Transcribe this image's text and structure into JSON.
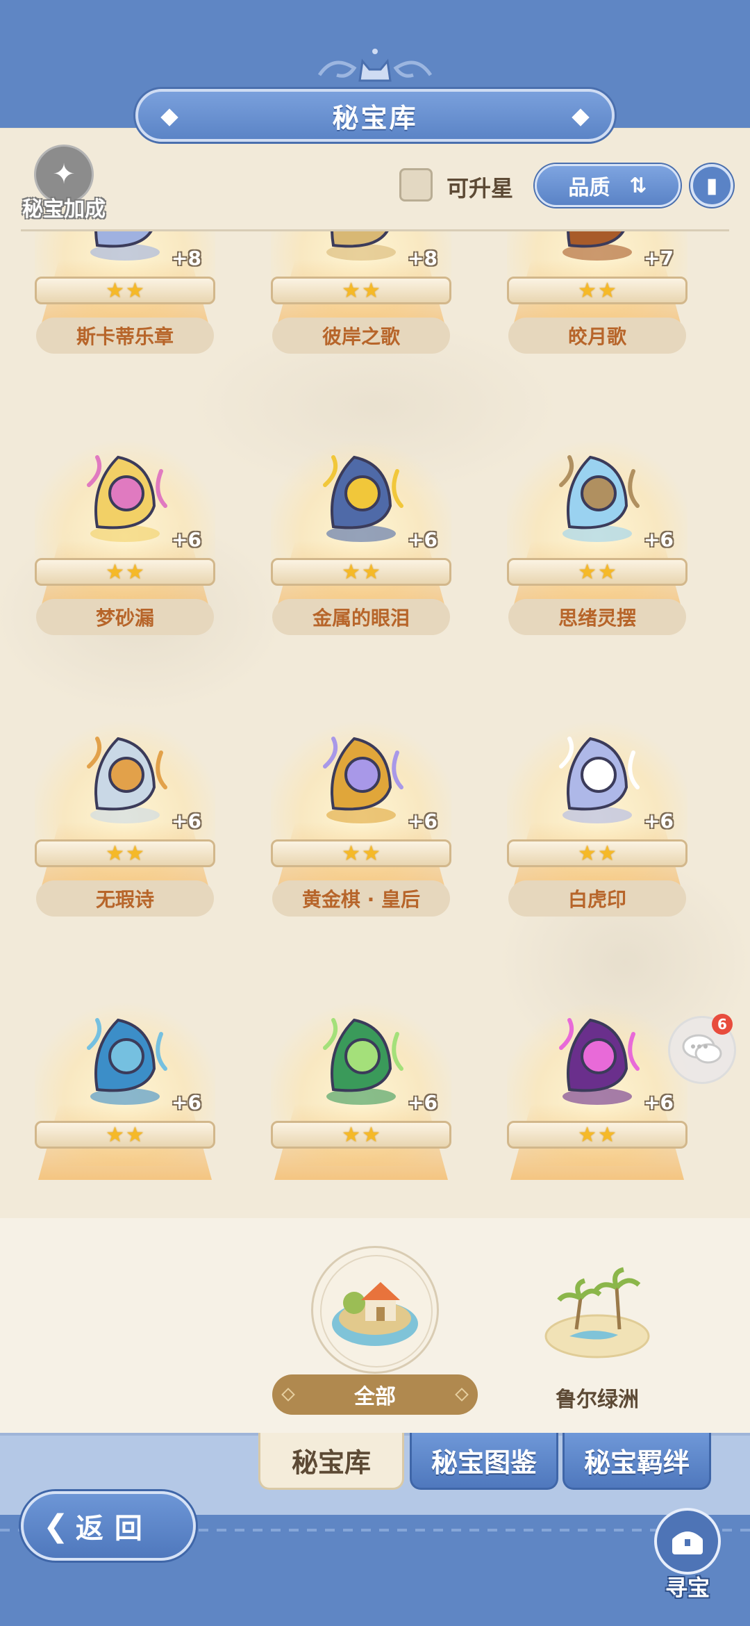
{
  "header": {
    "title": "秘宝库"
  },
  "toolbar": {
    "bonus_label": "秘宝加成",
    "upgradeable_label": "可升星",
    "quality_sort_label": "品质"
  },
  "items": [
    {
      "name": "斯卡蒂乐章",
      "level": "+8",
      "stars": 2,
      "icon": "lyre-icon"
    },
    {
      "name": "彼岸之歌",
      "level": "+8",
      "stars": 2,
      "icon": "lute-icon"
    },
    {
      "name": "皎月歌",
      "level": "+7",
      "stars": 2,
      "icon": "horn-icon"
    },
    {
      "name": "梦砂漏",
      "level": "+6",
      "stars": 2,
      "icon": "hourglass-icon"
    },
    {
      "name": "金属的眼泪",
      "level": "+6",
      "stars": 2,
      "icon": "shield-eye-icon"
    },
    {
      "name": "思绪灵摆",
      "level": "+6",
      "stars": 2,
      "icon": "crystal-pendulum-icon"
    },
    {
      "name": "无瑕诗",
      "level": "+6",
      "stars": 2,
      "icon": "book-icon"
    },
    {
      "name": "黄金棋 · 皇后",
      "level": "+6",
      "stars": 2,
      "icon": "chess-queen-icon"
    },
    {
      "name": "白虎印",
      "level": "+6",
      "stars": 2,
      "icon": "white-tiger-seal-icon"
    },
    {
      "name": "",
      "level": "+6",
      "stars": 2,
      "icon": "turtle-snake-seal-icon"
    },
    {
      "name": "",
      "level": "+6",
      "stars": 2,
      "icon": "dragon-seal-icon"
    },
    {
      "name": "",
      "level": "+6",
      "stars": 2,
      "icon": "vortex-orb-icon"
    }
  ],
  "chat": {
    "badge_count": "6"
  },
  "regions": {
    "all_label": "全部",
    "oasis_label": "鲁尔绿洲"
  },
  "tabs": [
    {
      "label": "秘宝库",
      "active": true
    },
    {
      "label": "秘宝图鉴",
      "active": false
    },
    {
      "label": "秘宝羁绊",
      "active": false
    }
  ],
  "footer": {
    "back_label": "返回",
    "treasure_hunt_label": "寻宝"
  },
  "colors": {
    "frame_blue": "#5f86c4",
    "parchment": "#f2ead9",
    "name_text": "#b7652a",
    "star_gold": "#f5b928"
  }
}
